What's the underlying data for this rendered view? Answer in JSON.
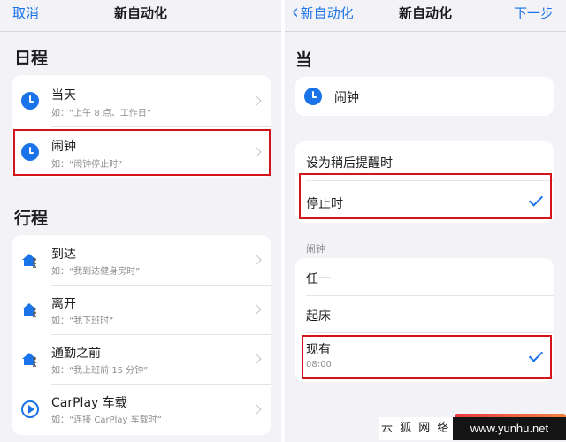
{
  "left": {
    "nav": {
      "cancel": "取消",
      "title": "新自动化"
    },
    "schedule": {
      "heading": "日程",
      "items": [
        {
          "title": "当天",
          "subtitle": "如：“上午 8 点、工作日”",
          "icon": "clock-icon"
        },
        {
          "title": "闹钟",
          "subtitle": "如：“闹钟停止时”",
          "icon": "clock-icon"
        }
      ]
    },
    "travel": {
      "heading": "行程",
      "items": [
        {
          "title": "到达",
          "subtitle": "如：“我到达健身房时”",
          "icon": "home-person-icon"
        },
        {
          "title": "离开",
          "subtitle": "如：“我下班时”",
          "icon": "home-person-icon"
        },
        {
          "title": "通勤之前",
          "subtitle": "如：“我上班前 15 分钟”",
          "icon": "home-person-icon"
        },
        {
          "title": "CarPlay 车载",
          "subtitle": "如：“连接 CarPlay 车载时”",
          "icon": "carplay-icon"
        }
      ]
    }
  },
  "right": {
    "nav": {
      "back": "新自动化",
      "title": "新自动化",
      "next": "下一步"
    },
    "when": {
      "heading": "当",
      "item": "闹钟",
      "icon": "clock-icon"
    },
    "options": [
      {
        "title": "设为稍后提醒时",
        "checked": false
      },
      {
        "title": "停止时",
        "checked": true
      }
    ],
    "alarm_section": {
      "label": "闹钟",
      "items": [
        {
          "title": "任一",
          "checked": false
        },
        {
          "title": "起床",
          "checked": false
        },
        {
          "title": "现有",
          "subtitle": "08:00",
          "checked": true
        }
      ]
    }
  },
  "watermark": {
    "text_cn": "云 狐 网 络",
    "url": "www.yunhu.net"
  },
  "colors": {
    "accent": "#1a73e8",
    "highlight": "#d3141c",
    "background": "#f2f2f7"
  }
}
